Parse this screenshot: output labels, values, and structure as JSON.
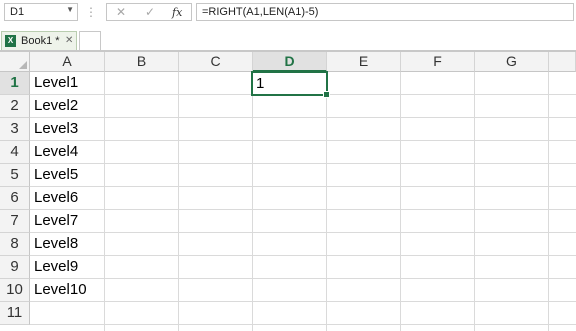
{
  "formula_bar": {
    "name_box": "D1",
    "cancel_icon": "✕",
    "enter_icon": "✓",
    "fx_label": "fx",
    "formula": "=RIGHT(A1,LEN(A1)-5)"
  },
  "workbook_tab": {
    "icon": "excel-icon",
    "title": "Book1 *",
    "close": "✕"
  },
  "grid": {
    "columns": [
      "A",
      "B",
      "C",
      "D",
      "E",
      "F",
      "G"
    ],
    "selected_column": "D",
    "rows": [
      "1",
      "2",
      "3",
      "4",
      "5",
      "6",
      "7",
      "8",
      "9",
      "10",
      "11"
    ],
    "selected_row": "1",
    "column_a": [
      "Level1",
      "Level2",
      "Level3",
      "Level4",
      "Level5",
      "Level6",
      "Level7",
      "Level8",
      "Level9",
      "Level10",
      ""
    ],
    "active_cell": {
      "ref": "D1",
      "value": "1"
    }
  },
  "colors": {
    "accent": "#217346",
    "header_bg": "#f3f3f3",
    "gridline": "#dadada"
  }
}
